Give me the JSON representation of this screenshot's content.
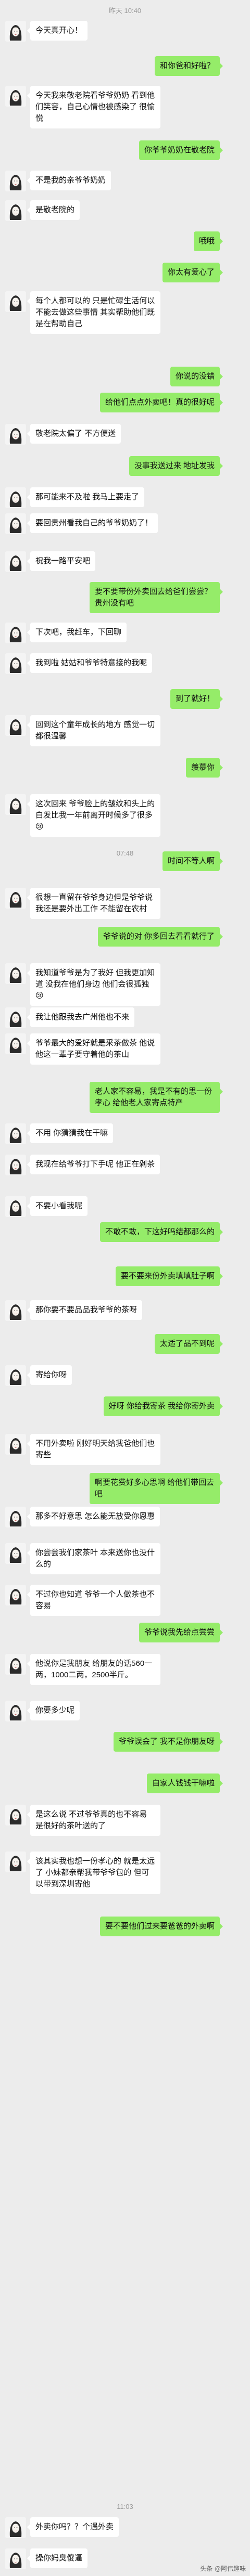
{
  "timestamps": [
    "昨天 10:40",
    "07:48",
    "11:03"
  ],
  "watermark": "头条 @阿伟趣味",
  "messages": [
    {
      "side": "left",
      "text": "今天真开心！"
    },
    {
      "side": "right",
      "text": "和你爸和好啦？"
    },
    {
      "side": "left",
      "text": "今天我来敬老院看爷爷奶奶 看到他们笑容，自己心情也被感染了 很愉悦"
    },
    {
      "side": "right",
      "text": "你爷爷奶奶在敬老院"
    },
    {
      "side": "left",
      "text": "不是我的亲爷爷奶奶"
    },
    {
      "side": "left",
      "text": "是敬老院的"
    },
    {
      "side": "right",
      "text": "哦哦"
    },
    {
      "side": "right",
      "text": "你太有爱心了"
    },
    {
      "side": "left",
      "text": "每个人都可以的 只是忙碌生活何以不能去做这些事情 其实帮助他们既是在帮助自己"
    },
    {
      "side": "right",
      "text": "你说的没错"
    },
    {
      "side": "right",
      "text": "给他们点点外卖吧！真的很好呢"
    },
    {
      "side": "left",
      "text": "敬老院太偏了 不方便送"
    },
    {
      "side": "right",
      "text": "没事我送过来 地址发我"
    },
    {
      "side": "left",
      "text": "那可能来不及啦 我马上要走了"
    },
    {
      "side": "left",
      "text": "要回贵州看我自己的爷爷奶奶了！"
    },
    {
      "side": "left",
      "text": "祝我一路平安吧"
    },
    {
      "side": "right",
      "text": "要不要带份外卖回去给爸们尝尝？ 贵州没有吧"
    },
    {
      "side": "left",
      "text": "下次吧，我赶车，下回聊"
    },
    {
      "side": "left",
      "text": "我到啦 姑姑和爷爷特意接的我呢"
    },
    {
      "side": "right",
      "text": "到了就好！"
    },
    {
      "side": "left",
      "text": "回到这个童年成长的地方 感觉一切都很温馨"
    },
    {
      "side": "right",
      "text": "羡慕你"
    },
    {
      "side": "left",
      "text": "这次回来 爷爷脸上的皱纹和头上的白发比我一年前离开时候多了很多😢"
    },
    {
      "side": "right",
      "text": "时间不等人啊"
    },
    {
      "side": "left",
      "text": "很想一直留在爷爷身边但是爷爷说我还是要外出工作 不能留在农村"
    },
    {
      "side": "right",
      "text": "爷爷说的对 你多回去看看就行了"
    },
    {
      "side": "left",
      "text": "我知道爷爷是为了我好 但我更加知道 没我在他们身边 他们会很孤独😢"
    },
    {
      "side": "left",
      "text": "我让他跟我去广州他也不来"
    },
    {
      "side": "left",
      "text": "爷爷最大的爱好就是采茶做茶 他说他这一辈子要守着他的茶山"
    },
    {
      "side": "right",
      "text": "老人家不容易，我是不有的思一份孝心 给他老人家寄点特产"
    },
    {
      "side": "left",
      "text": "不用 你猜猜我在干嘛"
    },
    {
      "side": "left",
      "text": "我现在给爷爷打下手呢 他正在剁茶"
    },
    {
      "side": "left",
      "text": "不要小看我呢"
    },
    {
      "side": "right",
      "text": "不敢不敢，下这好吗结都那么的"
    },
    {
      "side": "right",
      "text": "要不要来份外卖填填肚子啊"
    },
    {
      "side": "left",
      "text": "那你要不要品品我爷爷的茶呀"
    },
    {
      "side": "right",
      "text": "太适了品不到呢"
    },
    {
      "side": "left",
      "text": "寄给你呀"
    },
    {
      "side": "right",
      "text": "好呀 你给我寄茶 我给你寄外卖"
    },
    {
      "side": "left",
      "text": "不用外卖啦 刚好明天给我爸他们也寄些"
    },
    {
      "side": "right",
      "text": "啊要花费好多心思啊 给他们带回去吧"
    },
    {
      "side": "left",
      "text": "那多不好意思 怎么能无放受你恩惠"
    },
    {
      "side": "left",
      "text": "你尝尝我们家茶叶 本来送你也没什么的"
    },
    {
      "side": "left",
      "text": "不过你也知道 爷爷一个人做茶也不容易"
    },
    {
      "side": "right",
      "text": "爷爷说我先给点尝尝"
    },
    {
      "side": "left",
      "text": "他说你是我朋友 给朋友的话560一两，1000二两，2500半斤。"
    },
    {
      "side": "left",
      "text": "你要多少呢"
    },
    {
      "side": "right",
      "text": "爷爷误会了 我不是你朋友呀"
    },
    {
      "side": "right",
      "text": "自家人钱钱干嘛啦"
    },
    {
      "side": "left",
      "text": "是这么说 不过爷爷真的也不容易 是很好的茶叶送的了"
    },
    {
      "side": "left",
      "text": "该其实我也想一份孝心的 就是太远了 小妹都亲帮我带爷爷包的 但可以带到深圳寄他"
    },
    {
      "side": "right",
      "text": "要不要他们过来要爸爸的外卖啊"
    },
    {
      "side": "left",
      "text": "外卖你吗？？个遇外卖"
    },
    {
      "side": "left",
      "text": "操你妈臭傻逼"
    }
  ]
}
